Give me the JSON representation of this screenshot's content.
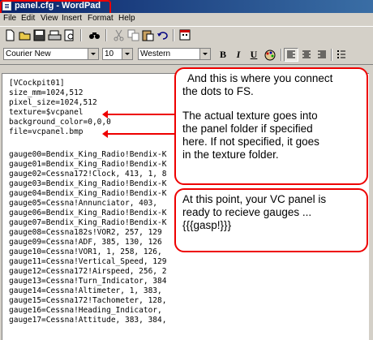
{
  "window": {
    "title": "panel.cfg - WordPad"
  },
  "menu": [
    "File",
    "Edit",
    "View",
    "Insert",
    "Format",
    "Help"
  ],
  "format_bar": {
    "font": "Courier New",
    "size": "10",
    "script": "Western",
    "bold": "B",
    "italic": "I",
    "underline": "U"
  },
  "document": {
    "lines": [
      "[VCockpit01]",
      "size_mm=1024,512",
      "pixel_size=1024,512",
      "texture=$vcpanel",
      "background_color=0,0,0",
      "file=vcpanel.bmp",
      "",
      "gauge00=Bendix_King_Radio!Bendix-K",
      "gauge01=Bendix_King_Radio!Bendix-K",
      "gauge02=Cessna172!Clock, 413, 1, 8",
      "gauge03=Bendix_King_Radio!Bendix-K",
      "gauge04=Bendix_King_Radio!Bendix-K",
      "gauge05=Cessna!Annunciator, 403,",
      "gauge06=Bendix_King_Radio!Bendix-K",
      "gauge07=Bendix_King_Radio!Bendix-K",
      "gauge08=Cessna182s!VOR2, 257, 129",
      "gauge09=Cessna!ADF, 385, 130, 126",
      "gauge10=Cessna!VOR1, 1, 258, 126,",
      "gauge11=Cessna!Vertical_Speed, 129",
      "gauge12=Cessna172!Airspeed, 256, 2",
      "gauge13=Cessna!Turn_Indicator, 384",
      "gauge14=Cessna!Altimeter, 1, 383,",
      "gauge15=Cessna172!Tachometer, 128,",
      "gauge16=Cessna!Heading_Indicator,",
      "gauge17=Cessna!Attitude, 383, 384,"
    ],
    "edge_fragments": [
      "7",
      "77"
    ]
  },
  "callouts": {
    "top": {
      "line1": "And this is where you connect",
      "line2": "the dots to FS.",
      "line3": "The actual texture goes into",
      "line4": "the panel folder if specified",
      "line5": "here.  If not specified, it goes",
      "line6": "in the texture folder."
    },
    "bottom": {
      "line1": "At this point, your VC panel is",
      "line2": "ready to recieve gauges ...",
      "line3": "{{{gasp!}}}"
    }
  },
  "colors": {
    "titlebar": "#0a246a",
    "annotation": "#e00000"
  }
}
